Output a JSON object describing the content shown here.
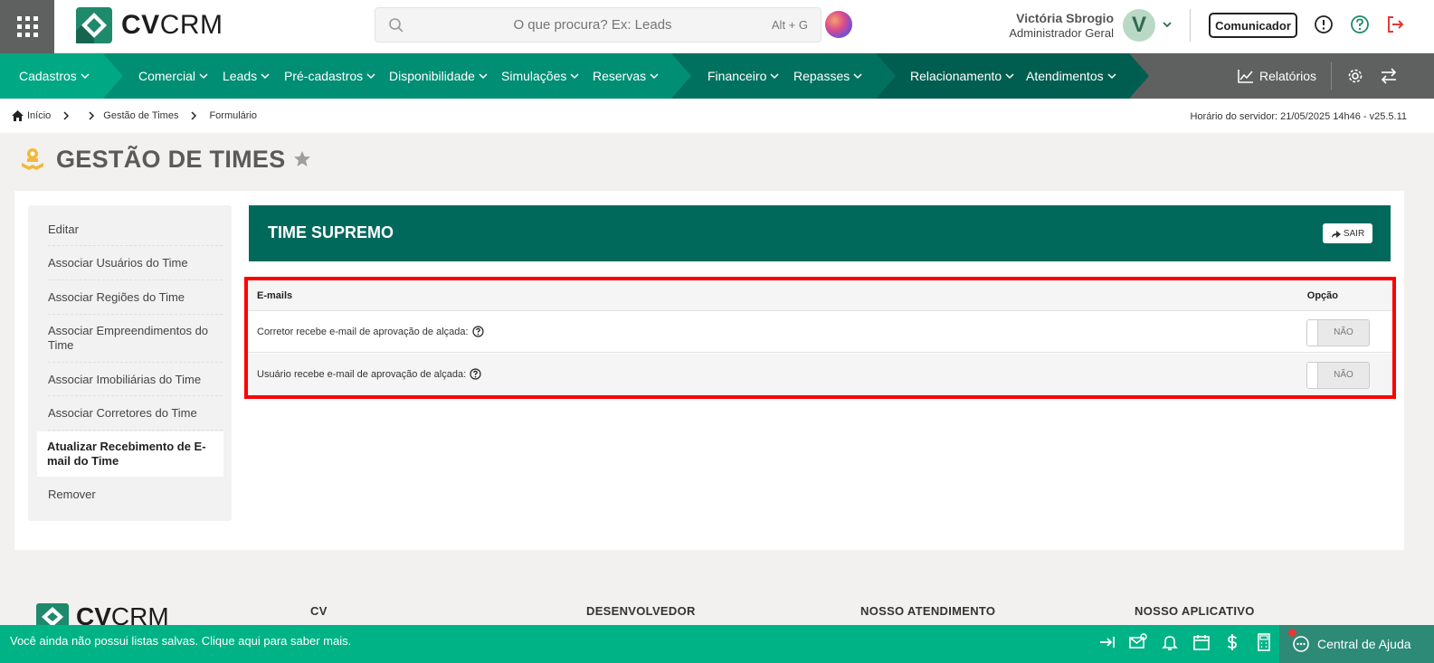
{
  "header": {
    "logo_text_bold": "CV",
    "logo_text": "CRM",
    "search_placeholder": "O que procura? Ex: Leads",
    "search_shortcut": "Alt + G",
    "user_name": "Victória Sbrogio",
    "user_role": "Administrador Geral",
    "avatar_initial": "V",
    "comunicador_label": "Comunicador"
  },
  "nav": {
    "groups": [
      {
        "label": "Cadastros",
        "color": "#00a884"
      },
      {
        "label": "Comercial",
        "color": "#008e74"
      },
      {
        "label": "Leads",
        "color": "#008e74"
      },
      {
        "label": "Pré-cadastros",
        "color": "#008e74"
      },
      {
        "label": "Disponibilidade",
        "color": "#008e74"
      },
      {
        "label": "Simulações",
        "color": "#008e74"
      },
      {
        "label": "Reservas",
        "color": "#008e74"
      },
      {
        "label": "Financeiro",
        "color": "#00715f"
      },
      {
        "label": "Repasses",
        "color": "#00715f"
      },
      {
        "label": "Relacionamento",
        "color": "#005e50"
      },
      {
        "label": "Atendimentos",
        "color": "#005e50"
      }
    ],
    "reports_label": "Relatórios"
  },
  "breadcrumb": {
    "home": "Início",
    "items": [
      "Gestão de Times",
      "Formulário"
    ],
    "server_time": "Horário do servidor: 21/05/2025 14h46 - v25.5.11"
  },
  "page": {
    "title": "GESTÃO DE TIMES"
  },
  "sidebar": {
    "items": [
      {
        "label": "Editar"
      },
      {
        "label": "Associar Usuários do Time"
      },
      {
        "label": "Associar Regiões do Time"
      },
      {
        "label": "Associar Empreendimentos do Time"
      },
      {
        "label": "Associar Imobiliárias do Time"
      },
      {
        "label": "Associar Corretores do Time"
      },
      {
        "label": "Atualizar Recebimento de E-mail do Time"
      },
      {
        "label": "Remover"
      }
    ]
  },
  "team": {
    "name": "TIME SUPREMO",
    "exit_label": "SAIR"
  },
  "emails_table": {
    "col_emails": "E-mails",
    "col_option": "Opção",
    "rows": [
      {
        "label": "Corretor recebe e-mail de aprovação de alçada:",
        "value": "NÃO"
      },
      {
        "label": "Usuário recebe e-mail de aprovação de alçada:",
        "value": "NÃO"
      }
    ]
  },
  "footer": {
    "headings": [
      "CV",
      "DESENVOLVEDOR",
      "NOSSO ATENDIMENTO",
      "NOSSO APLICATIVO"
    ]
  },
  "bottombar": {
    "message": "Você ainda não possui listas salvas. Clique aqui para saber mais.",
    "help_label": "Central de Ajuda"
  },
  "colors": {
    "brand_green": "#00b386",
    "banner_green": "#00695c",
    "highlight_red": "#ff0000"
  }
}
